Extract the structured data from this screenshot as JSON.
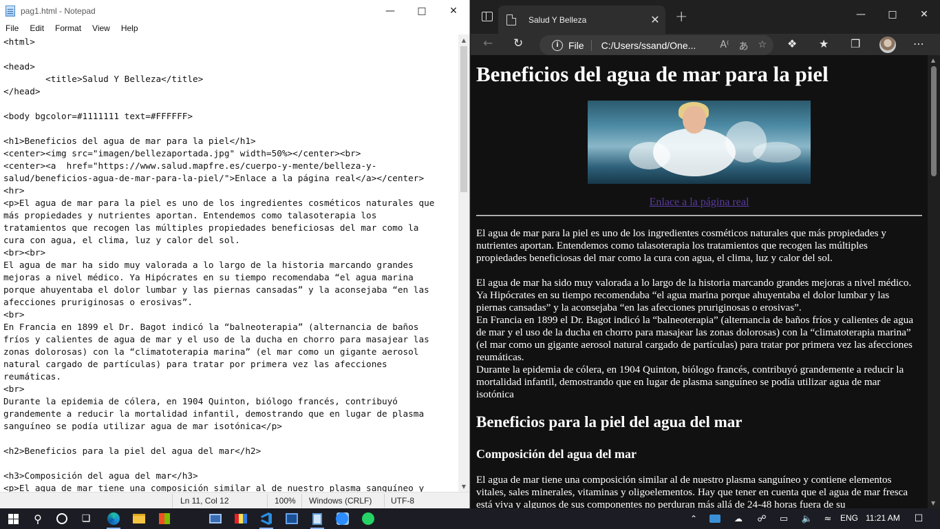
{
  "notepad": {
    "title": "pag1.html - Notepad",
    "menu": [
      "File",
      "Edit",
      "Format",
      "View",
      "Help"
    ],
    "content": "<html>\n\n<head>\n        <title>Salud Y Belleza</title>\n</head>\n\n<body bgcolor=#1111111 text=#FFFFFF>\n\n<h1>Beneficios del agua de mar para la piel</h1>\n<center><img src=\"imagen/bellezaportada.jpg\" width=50%></center><br>\n<center><a  href=\"https://www.salud.mapfre.es/cuerpo-y-mente/belleza-y-\nsalud/beneficios-agua-de-mar-para-la-piel/\">Enlace a la página real</a></center>\n<hr>\n<p>El agua de mar para la piel es uno de los ingredientes cosméticos naturales que\nmás propiedades y nutrientes aportan. Entendemos como talasoterapia los\ntratamientos que recogen las múltiples propiedades beneficiosas del mar como la\ncura con agua, el clima, luz y calor del sol.\n<br><br>\nEl agua de mar ha sido muy valorada a lo largo de la historia marcando grandes\nmejoras a nivel médico. Ya Hipócrates en su tiempo recomendaba “el agua marina\nporque ahuyentaba el dolor lumbar y las piernas cansadas” y la aconsejaba “en las\nafecciones pruriginosas o erosivas”.\n<br>\nEn Francia en 1899 el Dr. Bagot indicó la “balneoterapia” (alternancia de baños\nfríos y calientes de agua de mar y el uso de la ducha en chorro para masajear las\nzonas dolorosas) con la “climatoterapia marina” (el mar como un gigante aerosol\nnatural cargado de partículas) para tratar por primera vez las afecciones\nreumáticas.\n<br>\nDurante la epidemia de cólera, en 1904 Quinton, biólogo francés, contribuyó\ngrandemente a reducir la mortalidad infantil, demostrando que en lugar de plasma\nsanguíneo se podía utilizar agua de mar isotónica</p>\n\n<h2>Beneficios para la piel del agua del mar</h2>\n\n<h3>Composición del agua del mar</h3>\n<p>El agua de mar tiene una composición similar al de nuestro plasma sanguíneo y",
    "status": {
      "position": "Ln 11, Col 12",
      "zoom": "100%",
      "line_endings": "Windows (CRLF)",
      "encoding": "UTF-8"
    }
  },
  "browser": {
    "tab_title": "Salud Y Belleza",
    "url_scheme": "File",
    "url": "C:/Users/ssand/One...",
    "page": {
      "h1": "Beneficios del agua de mar para la piel",
      "link_text": "Enlace a la página real",
      "p1": "El agua de mar para la piel es uno de los ingredientes cosméticos naturales que más propiedades y nutrientes aportan. Entendemos como talasoterapia los tratamientos que recogen las múltiples propiedades beneficiosas del mar como la cura con agua, el clima, luz y calor del sol.",
      "p2": "El agua de mar ha sido muy valorada a lo largo de la historia marcando grandes mejoras a nivel médico. Ya Hipócrates en su tiempo recomendaba “el agua marina porque ahuyentaba el dolor lumbar y las piernas cansadas” y la aconsejaba “en las afecciones pruriginosas o erosivas”.",
      "p3": "En Francia en 1899 el Dr. Bagot indicó la “balneoterapia” (alternancia de baños fríos y calientes de agua de mar y el uso de la ducha en chorro para masajear las zonas dolorosas) con la “climatoterapia marina” (el mar como un gigante aerosol natural cargado de partículas) para tratar por primera vez las afecciones reumáticas.",
      "p4": "Durante la epidemia de cólera, en 1904 Quinton, biólogo francés, contribuyó grandemente a reducir la mortalidad infantil, demostrando que en lugar de plasma sanguíneo se podía utilizar agua de mar isotónica",
      "h2": "Beneficios para la piel del agua del mar",
      "h3": "Composición del agua del mar",
      "p5": "El agua de mar tiene una composición similar al de nuestro plasma sanguíneo y contiene elementos vitales, sales minerales, vitaminas y oligoelementos. Hay que tener en cuenta que el agua de mar fresca está viva y algunos de sus componentes no perduran más allá de 24-48 horas fuera de su"
    }
  },
  "taskbar": {
    "lang": "ENG",
    "time": "11:21 AM"
  },
  "colors": {
    "page_bg": "#111111",
    "link": "#5a3aa0",
    "taskbar": "#1c1d24"
  }
}
